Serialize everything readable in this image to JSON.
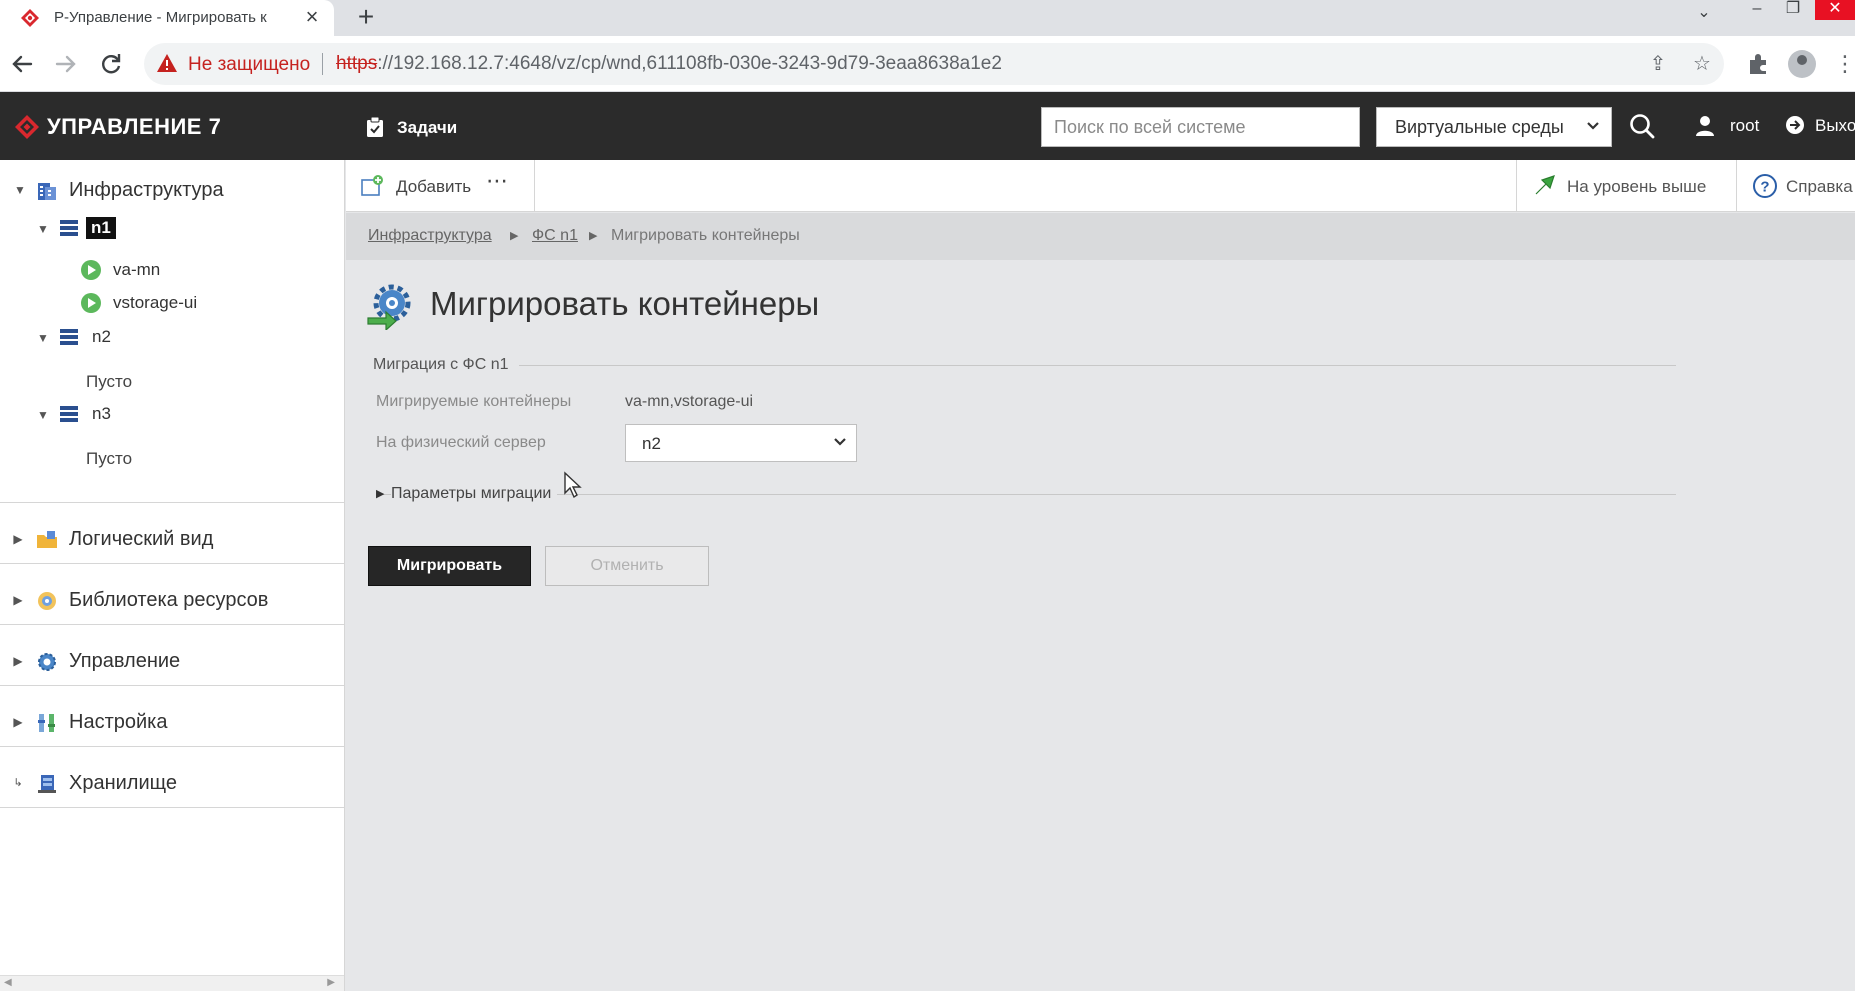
{
  "browser": {
    "tab_title": "Р-Управление - Мигрировать к",
    "tab_close": "×",
    "new_tab": "+",
    "security_label": "Не защищено",
    "url_scheme": "https",
    "url_rest": "://192.168.12.7:4648/vz/cp/wnd,611108fb-030e-3243-9d79-3eaa8638a1e2",
    "window_controls": [
      "⌄",
      "–",
      "❐",
      "✕"
    ]
  },
  "header": {
    "brand": "УПРАВЛЕНИЕ 7",
    "tasks_label": "Задачи",
    "search_placeholder": "Поиск по всей системе",
    "env_select": "Виртуальные среды",
    "user": "root",
    "logout": "Выход"
  },
  "sidebar": {
    "infrastructure": {
      "label": "Инфраструктура",
      "nodes": [
        {
          "label": "n1",
          "selected": true,
          "children": [
            "va-mn",
            "vstorage-ui"
          ]
        },
        {
          "label": "n2",
          "empty_text": "Пусто"
        },
        {
          "label": "n3",
          "empty_text": "Пусто"
        }
      ]
    },
    "sections": [
      "Логический вид",
      "Библиотека ресурсов",
      "Управление",
      "Настройка",
      "Хранилище"
    ]
  },
  "actionbar": {
    "add": "Добавить",
    "more": "⋯",
    "up": "На уровень выше",
    "help": "Справка"
  },
  "breadcrumb": {
    "items": [
      "Инфраструктура",
      "ФС n1"
    ],
    "current": "Мигрировать контейнеры"
  },
  "page": {
    "title": "Мигрировать контейнеры",
    "fieldset_legend": "Миграция с ФС n1",
    "containers_label": "Мигрируемые контейнеры",
    "containers_value": "va-mn,vstorage-ui",
    "server_label": "На физический сервер",
    "server_value": "n2",
    "advanced_label": "Параметры миграции",
    "migrate_button": "Мигрировать",
    "cancel_button": "Отменить"
  },
  "colors": {
    "header_bg": "#2b2b2b",
    "brand_red": "#d9282e",
    "running_green": "#5cb85c",
    "server_blue": "#2a4f8f"
  }
}
